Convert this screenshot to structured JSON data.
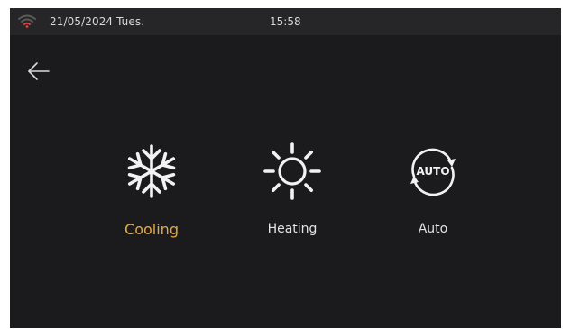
{
  "status_bar": {
    "date": "21/05/2024 Tues.",
    "time": "15:58",
    "wifi_icon": "wifi-icon",
    "wifi_color": "#d9473f"
  },
  "nav": {
    "back_icon": "back-arrow-icon"
  },
  "modes": [
    {
      "label": "Cooling",
      "icon": "snowflake-icon",
      "selected": true
    },
    {
      "label": "Heating",
      "icon": "sun-icon",
      "selected": false
    },
    {
      "label": "Auto",
      "icon": "auto-cycle-icon",
      "badge_text": "AUTO",
      "selected": false
    }
  ],
  "colors": {
    "background": "#1b1b1d",
    "status_bar": "#262628",
    "active_label": "#e7a843",
    "text": "#e3e3e3"
  }
}
